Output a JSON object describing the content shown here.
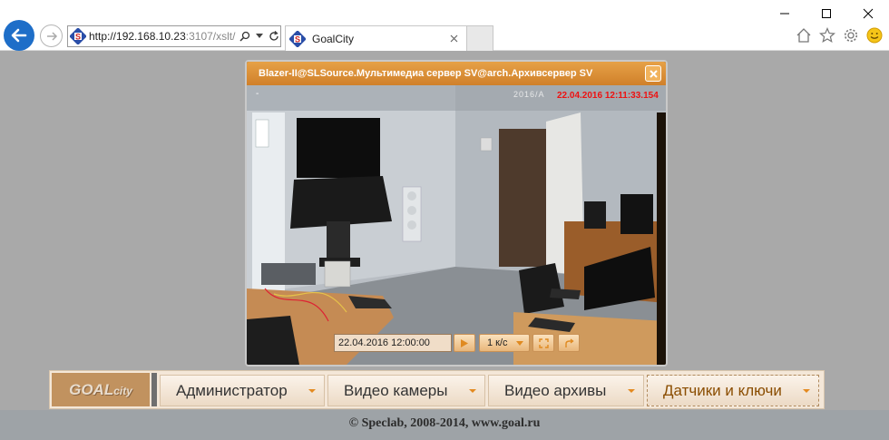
{
  "browser": {
    "url_main": "http://192.168.10.23",
    "url_rest": ":3107/xslt/",
    "tab_title": "GoalCity",
    "icons": [
      "back-arrow-icon",
      "forward-arrow-icon",
      "search-icon",
      "dropdown-icon",
      "refresh-icon",
      "close-icon",
      "home-icon",
      "star-icon",
      "gear-icon",
      "smiley-icon"
    ]
  },
  "video": {
    "title": "Blazer-II@SLSource.Мультимедиа сервер SV@arch.Архивсервер SV",
    "osd_dash": "-",
    "osd_ghost": "2016/А",
    "timestamp": "22.04.2016 12:11:33.154",
    "datetime_value": "22.04.2016 12:00:00",
    "speed_label": "1 к/с"
  },
  "menu": {
    "logo_main": "GOAL",
    "logo_sub": "city",
    "items": [
      {
        "label": "Администратор"
      },
      {
        "label": "Видео камеры"
      },
      {
        "label": "Видео архивы"
      },
      {
        "label": "Датчики и ключи"
      }
    ]
  },
  "footer": {
    "text": "© Speclab, 2008-2014, www.goal.ru"
  },
  "colors": {
    "accent": "#d0802a",
    "timestamp": "#e11111",
    "back_button": "#1e6ec8",
    "page_bg": "#a9a9a9"
  }
}
